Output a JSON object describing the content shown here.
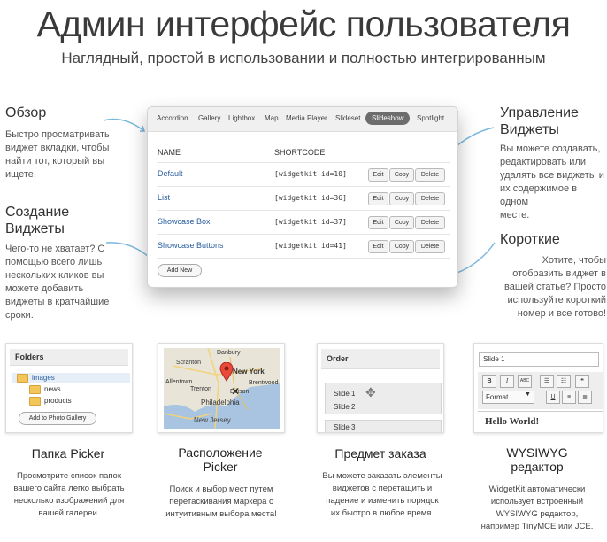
{
  "header": {
    "title": "Админ интерфейс пользователя",
    "subtitle": "Наглядный, простой в использовании и полностью интегрированным"
  },
  "left": [
    {
      "title": "Обзор",
      "text": [
        "Быстро просматривать",
        "виджет вкладки, чтобы",
        "найти тот, который вы",
        "ищете."
      ]
    },
    {
      "title_lines": [
        "Создание",
        "Виджеты"
      ],
      "text": [
        "Чего-то не хватает? С",
        "помощью всего лишь",
        "нескольких кликов вы",
        "можете добавить",
        "виджеты в кратчайшие",
        "сроки."
      ]
    }
  ],
  "right": [
    {
      "title_lines": [
        "Управление",
        "Виджеты"
      ],
      "text": [
        "Вы можете создавать,",
        "редактировать или",
        "удалять все виджеты и",
        "их содержимое в одном",
        "месте."
      ]
    },
    {
      "title": "Короткие",
      "text": [
        "Хотите, чтобы",
        "отобразить виджет в",
        "вашей статье? Просто",
        "используйте короткий",
        "номер и все готово!"
      ]
    }
  ],
  "panel": {
    "tabs": [
      "Accordion",
      "Gallery",
      "Lightbox",
      "Map",
      "Media Player",
      "Slideset",
      "Slideshow",
      "Spotlight"
    ],
    "active_tab": "Slideshow",
    "col_name": "NAME",
    "col_shortcode": "SHORTCODE",
    "rows": [
      {
        "name": "Default",
        "code": "[widgetkit id=10]"
      },
      {
        "name": "List",
        "code": "[widgetkit id=36]"
      },
      {
        "name": "Showcase Box",
        "code": "[widgetkit id=37]"
      },
      {
        "name": "Showcase Buttons",
        "code": "[widgetkit id=41]"
      }
    ],
    "edit_label": "Edit",
    "copy_label": "Copy",
    "delete_label": "Delete",
    "add_new_label": "Add New"
  },
  "cards": [
    {
      "title": "Папка Picker",
      "desc": [
        "Просмотрите список папок",
        "вашего сайта легко выбрать",
        "несколько изображений для",
        "вашей галереи."
      ],
      "ui": {
        "header": "Folders",
        "folders": [
          "images",
          "news",
          "products"
        ],
        "button": "Add to Photo Gallery"
      }
    },
    {
      "title_lines": [
        "Расположение",
        "Picker"
      ],
      "desc": [
        "Поиск и выбор мест путем",
        "перетаскивания маркера с",
        "интуитивным выбора места!"
      ],
      "ui": {
        "labels": [
          "Danbury",
          "Scranton",
          "New York",
          "Brentwood",
          "Allentown",
          "Trenton",
          "Edison",
          "Philadelphia",
          "New Jersey"
        ]
      }
    },
    {
      "title": "Предмет заказа",
      "desc": [
        "Вы можете заказать элементы",
        "виджетов с перетащить и",
        "падение и изменить порядок",
        "их быстро в любое время."
      ],
      "ui": {
        "header": "Order",
        "slides": [
          "Slide 1",
          "Slide 2",
          "Slide 3"
        ]
      }
    },
    {
      "title_lines": [
        "WYSIWYG",
        "редактор"
      ],
      "desc": [
        "WidgetKit автоматически",
        "использует встроенный",
        "WYSIWYG редактор,",
        "например TinyMCE или JCE."
      ],
      "ui": {
        "input": "Slide 1",
        "format": "Format",
        "content": "Hello World!"
      }
    }
  ]
}
